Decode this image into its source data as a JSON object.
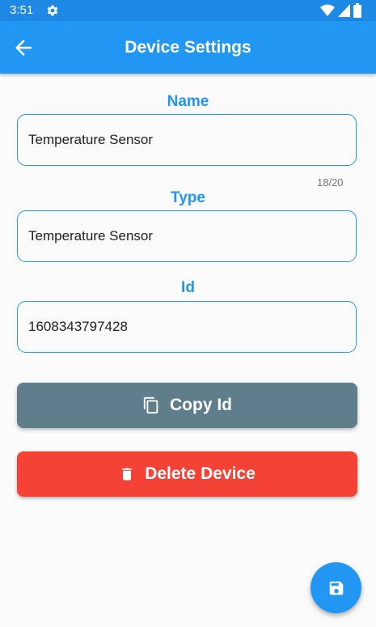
{
  "status_bar": {
    "time": "3:51",
    "icons": [
      "settings-icon",
      "wifi-icon",
      "signal-icon",
      "battery-icon"
    ]
  },
  "app_bar": {
    "title": "Device Settings",
    "back_icon": "arrow-back-icon"
  },
  "form": {
    "name": {
      "label": "Name",
      "value": "Temperature Sensor",
      "counter": "18/20"
    },
    "type": {
      "label": "Type",
      "value": "Temperature Sensor"
    },
    "id": {
      "label": "Id",
      "value": "1608343797428"
    }
  },
  "buttons": {
    "copy_label": "Copy Id",
    "copy_icon": "copy-icon",
    "delete_label": "Delete Device",
    "delete_icon": "trash-icon"
  },
  "fab": {
    "icon": "save-icon"
  },
  "colors": {
    "primary": "#2196f3",
    "status_bar": "#1e88e5",
    "copy_button": "#607d8b",
    "delete_button": "#f44336",
    "background": "#fafafa"
  }
}
